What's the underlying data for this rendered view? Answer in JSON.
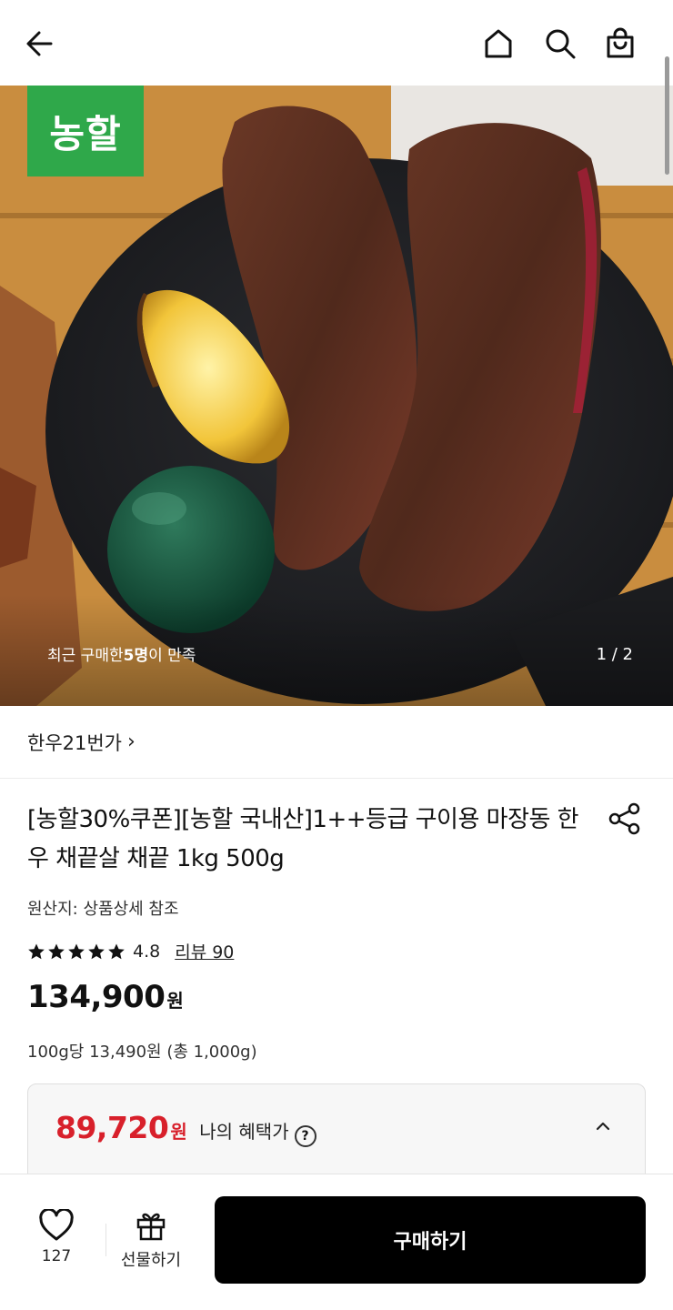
{
  "header": {
    "back_icon": "arrow-left-icon",
    "home_icon": "home-icon",
    "search_icon": "search-icon",
    "cart_icon": "shopping-bag-icon"
  },
  "hero": {
    "logo_text": "농할",
    "logo_color": "#2fa84a",
    "satisfied_prefix": "최근 구매한 ",
    "satisfied_count": "5명",
    "satisfied_suffix": "이 만족",
    "counter": "1 / 2"
  },
  "store": {
    "name": "한우21번가",
    "chevron": "›"
  },
  "product": {
    "title": "[농할30%쿠폰][농할 국내산]1++등급 구이용 마장동 한우 채끝살 채끝 1kg 500g",
    "origin": "원산지: 상품상세 참조",
    "rating_stars": 5,
    "rating": "4.8",
    "review_link": "리뷰 90",
    "price": "134,900",
    "price_unit": "원",
    "unit_price": "100g당 13,490원 (총 1,000g)"
  },
  "benefit": {
    "price": "89,720",
    "price_unit": "원",
    "label": "나의 혜택가",
    "help": "?",
    "accent": "#d8202b"
  },
  "bottom": {
    "like_count": "127",
    "gift_label": "선물하기",
    "buy_label": "구매하기"
  }
}
